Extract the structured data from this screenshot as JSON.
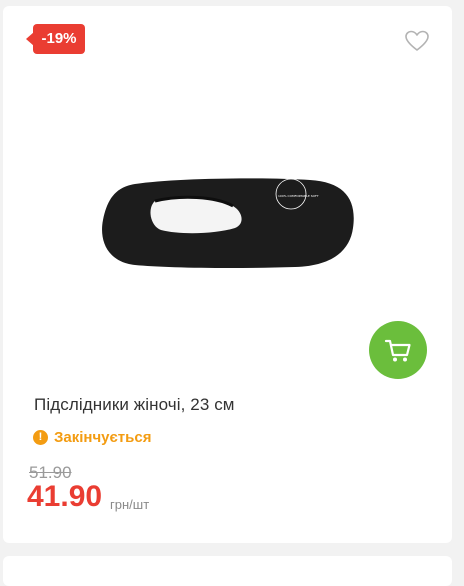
{
  "product": {
    "discount_badge": "-19%",
    "title": "Підслідники жіночі, 23 см",
    "status": "Закінчується",
    "old_price": "51.90",
    "new_price": "41.90",
    "unit": "грн/шт",
    "image_print": "100% COMFORTABLE SOFT"
  },
  "icons": {
    "wishlist": "heart-icon",
    "cart": "cart-icon",
    "status": "warning-icon"
  },
  "colors": {
    "badge": "#ea3d32",
    "cart_button": "#6bbe3c",
    "status": "#f39c12",
    "price": "#ea3d32"
  }
}
